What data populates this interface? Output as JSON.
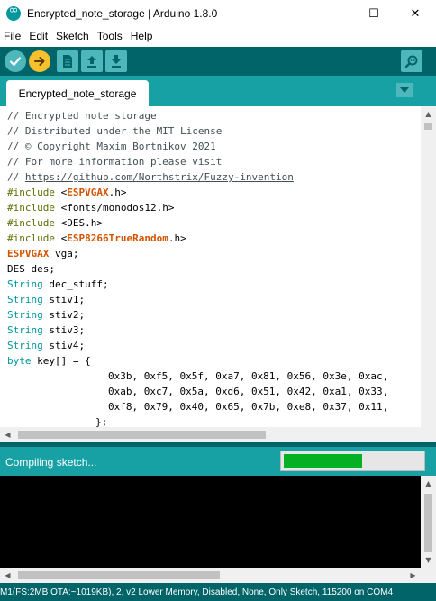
{
  "window": {
    "title": "Encrypted_note_storage | Arduino 1.8.0",
    "minimize_glyph": "—",
    "maximize_glyph": "☐",
    "close_glyph": "✕"
  },
  "menu": [
    "File",
    "Edit",
    "Sketch",
    "Tools",
    "Help"
  ],
  "toolbar": {
    "buttons": [
      "verify-icon",
      "upload-icon",
      "new-icon",
      "open-icon",
      "save-icon",
      "serial-monitor-icon"
    ],
    "colors": {
      "bar": "#006468",
      "button": "#4db7bb",
      "upload": "#f6c12c"
    }
  },
  "tabs": [
    {
      "label": "Encrypted_note_storage"
    }
  ],
  "editor": {
    "lines": [
      {
        "text": "// Encrypted note storage"
      },
      {
        "text": "// Distributed under the MIT License"
      },
      {
        "text": "// © Copyright Maxim Bortnikov 2021"
      },
      {
        "text": "// For more information please visit"
      },
      {
        "prefix": "// ",
        "link": "https://github.com/Northstrix/Fuzzy-invention"
      },
      {
        "directive": "#include",
        "open": " <",
        "lib": "ESPVGAX",
        "close": ".h>"
      },
      {
        "directive": "#include",
        "rest": " <fonts/monodos12.h>"
      },
      {
        "directive": "#include",
        "rest": " <DES.h>"
      },
      {
        "directive": "#include",
        "open": " <",
        "lib": "ESP8266TrueRandom",
        "close": ".h>"
      },
      {
        "lib": "ESPVGAX",
        "rest": " vga;"
      },
      {
        "rest": "DES des;"
      },
      {
        "type": "String",
        "rest": " dec_stuff;"
      },
      {
        "type": "String",
        "rest": " stiv1;"
      },
      {
        "type": "String",
        "rest": " stiv2;"
      },
      {
        "type": "String",
        "rest": " stiv3;"
      },
      {
        "type": "String",
        "rest": " stiv4;"
      },
      {
        "type": "byte",
        "rest": " key[] = {"
      },
      {
        "indent": 16,
        "rest": "0x3b, 0xf5, 0x5f, 0xa7, 0x81, 0x56, 0x3e, 0xac,"
      },
      {
        "indent": 16,
        "rest": "0xab, 0xc7, 0x5a, 0xd6, 0x51, 0x42, 0xa1, 0x33,"
      },
      {
        "indent": 16,
        "rest": "0xf8, 0x79, 0x40, 0x65, 0x7b, 0xe8, 0x37, 0x11,"
      },
      {
        "indent": 14,
        "rest": "};"
      }
    ]
  },
  "status": {
    "text": "Compiling sketch...",
    "progress": 0.57,
    "progress_color": "#06b025"
  },
  "footer": {
    "text": "M1(FS:2MB OTA:~1019KB), 2, v2 Lower Memory, Disabled, None, Only Sketch, 115200 on COM4"
  }
}
